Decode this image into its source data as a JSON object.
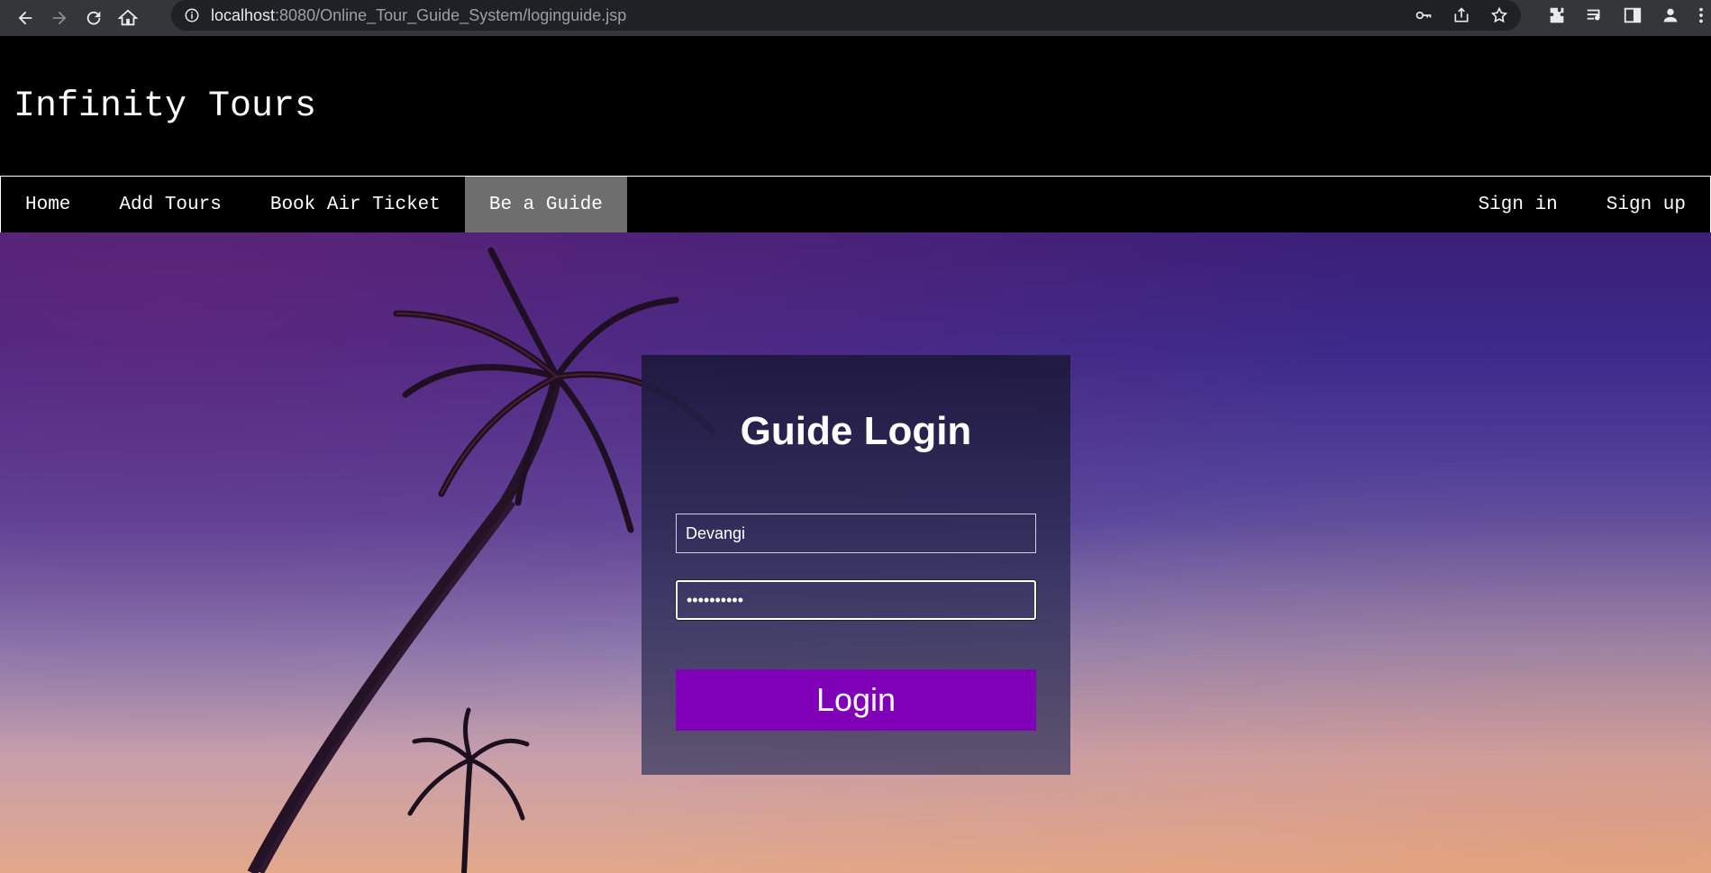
{
  "browser": {
    "url_host": "localhost",
    "url_path": ":8080/Online_Tour_Guide_System/loginguide.jsp",
    "icons": [
      "back-icon",
      "forward-icon",
      "reload-icon",
      "home-icon",
      "info-icon",
      "key-icon",
      "share-icon",
      "star-icon",
      "extensions-icon",
      "media-icon",
      "sidepanel-icon",
      "profile-icon",
      "menu-icon"
    ]
  },
  "site": {
    "title": "Infinity Tours"
  },
  "nav": {
    "left": [
      {
        "label": "Home"
      },
      {
        "label": "Add Tours"
      },
      {
        "label": "Book Air Ticket"
      },
      {
        "label": "Be a Guide",
        "active": true
      }
    ],
    "right": [
      {
        "label": "Sign in"
      },
      {
        "label": "Sign up"
      }
    ]
  },
  "login": {
    "title": "Guide Login",
    "username_value": "Devangi",
    "password_value": "••••••••••",
    "button_label": "Login"
  },
  "colors": {
    "header_bg": "#000000",
    "active_nav": "#6e6e6e",
    "login_button": "#8000b8"
  }
}
